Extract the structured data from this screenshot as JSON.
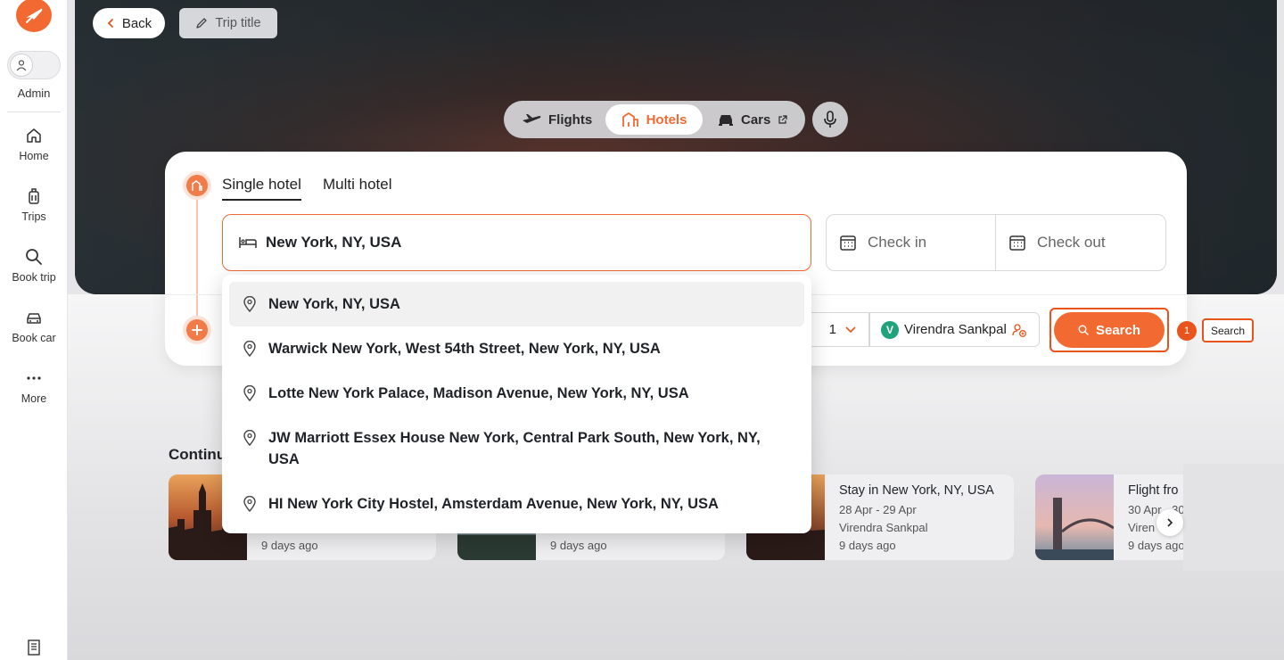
{
  "sidebar": {
    "user_label": "Admin",
    "items": [
      {
        "label": "Home",
        "icon": "home-icon"
      },
      {
        "label": "Trips",
        "icon": "luggage-icon"
      },
      {
        "label": "Book trip",
        "icon": "search-icon"
      },
      {
        "label": "Book car",
        "icon": "car-icon"
      },
      {
        "label": "More",
        "icon": "more-icon"
      }
    ]
  },
  "header": {
    "back_label": "Back",
    "trip_title_label": "Trip title"
  },
  "modes": {
    "flights": "Flights",
    "hotels": "Hotels",
    "cars": "Cars",
    "active": "Hotels"
  },
  "search": {
    "tabs": [
      "Single hotel",
      "Multi hotel"
    ],
    "active_tab": "Single hotel",
    "destination_value": "New York, NY, USA",
    "check_in_placeholder": "Check in",
    "check_out_placeholder": "Check out",
    "rooms_value": "1",
    "traveler_initial": "V",
    "traveler_name": "Virendra Sankpal",
    "search_label": "Search"
  },
  "annotation": {
    "number": "1",
    "label": "Search"
  },
  "suggestions": [
    "New York, NY, USA",
    "Warwick New York, West 54th Street, New York, NY, USA",
    "Lotte New York Palace, Madison Avenue, New York, NY, USA",
    "JW Marriott Essex House New York, Central Park South, New York, NY, USA",
    "HI New York City Hostel, Amsterdam Avenue, New York, NY, USA"
  ],
  "continue": {
    "title": "Continu",
    "cards": [
      {
        "title": "",
        "dates": "",
        "name": "",
        "ago": "9 days ago"
      },
      {
        "title": "",
        "dates": "",
        "name": "",
        "ago": "9 days ago"
      },
      {
        "title": "Stay in New York, NY, USA",
        "dates": "28 Apr - 29 Apr",
        "name": "Virendra Sankpal",
        "ago": "9 days ago"
      },
      {
        "title": "Flight fro",
        "dates": "30 Apr - 30",
        "name": "Viren",
        "ago": "9 days ago"
      }
    ]
  },
  "colors": {
    "accent": "#f26a32",
    "outline": "#e8541c",
    "traveler_badge": "#1fa37a"
  }
}
